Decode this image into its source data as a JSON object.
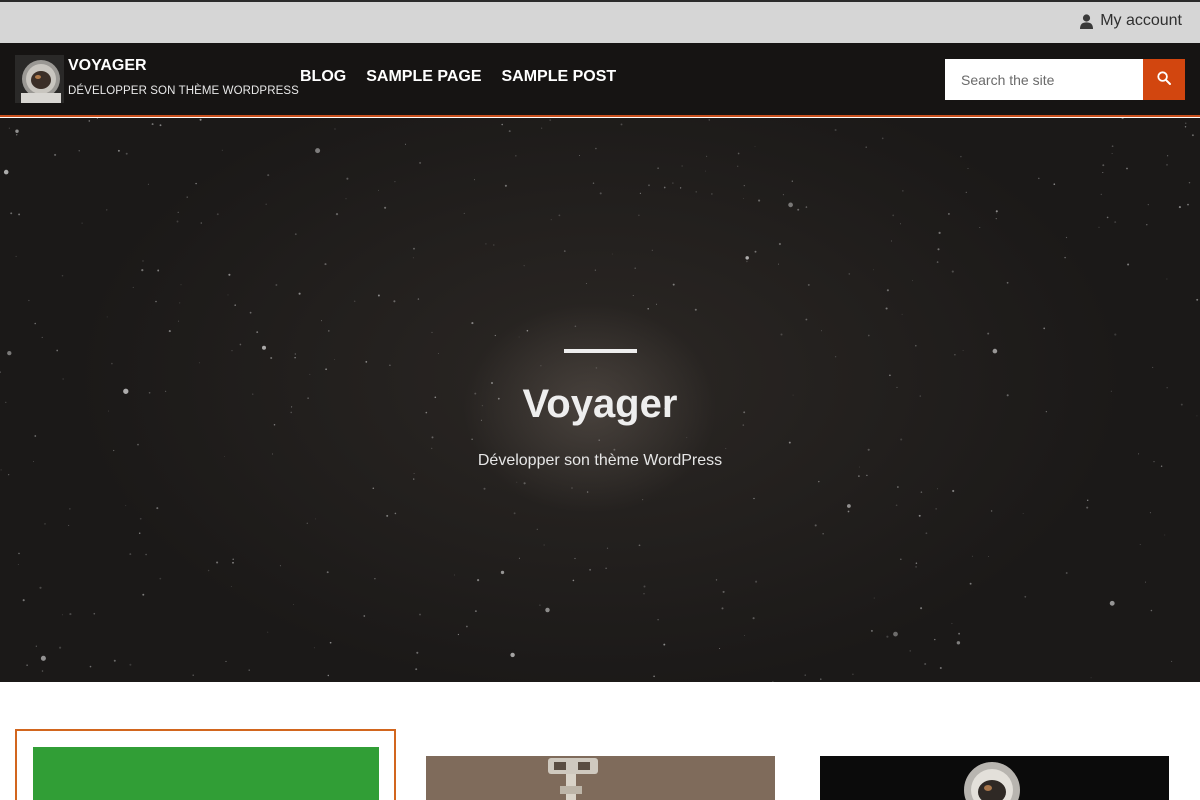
{
  "topbar": {
    "account_label": "My account",
    "account_icon": "user-icon"
  },
  "header": {
    "site_title": "VOYAGER",
    "tagline": "DÉVELOPPER SON THÈME WORDPRESS",
    "logo_icon": "astronaut-logo",
    "nav": [
      {
        "label": "BLOG"
      },
      {
        "label": "SAMPLE PAGE"
      },
      {
        "label": "SAMPLE POST"
      }
    ],
    "search": {
      "placeholder": "Search the site",
      "button_icon": "search-icon"
    }
  },
  "hero": {
    "title": "Voyager",
    "subtitle": "Développer son thème WordPress"
  },
  "colors": {
    "accent": "#d2460f",
    "header_bg": "#161413",
    "topbar_bg": "#d6d6d6",
    "featured_thumb": "#319e36"
  }
}
